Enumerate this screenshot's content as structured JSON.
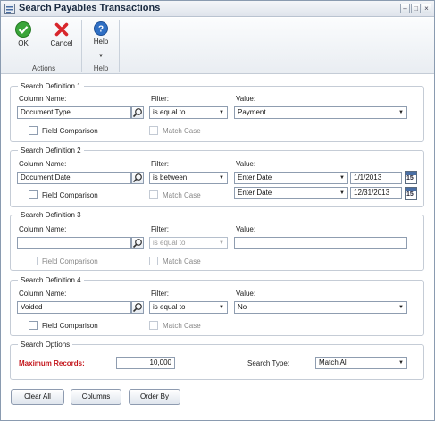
{
  "window": {
    "title": "Search Payables Transactions"
  },
  "ribbon": {
    "ok_label": "OK",
    "cancel_label": "Cancel",
    "help_label": "Help",
    "actions_group": "Actions",
    "help_group": "Help"
  },
  "labels": {
    "column_name": "Column Name:",
    "filter": "Filter:",
    "value": "Value:",
    "field_comparison": "Field Comparison",
    "match_case": "Match Case"
  },
  "def1": {
    "title": "Search Definition 1",
    "column": "Document Type",
    "filter": "is equal to",
    "value": "Payment"
  },
  "def2": {
    "title": "Search Definition 2",
    "column": "Document Date",
    "filter": "is between",
    "value1_type": "Enter Date",
    "value1_date": "1/1/2013",
    "value2_type": "Enter Date",
    "value2_date": "12/31/2013",
    "calendar_day": "15"
  },
  "def3": {
    "title": "Search Definition 3",
    "column": "",
    "filter": "is equal to",
    "value": ""
  },
  "def4": {
    "title": "Search Definition 4",
    "column": "Voided",
    "filter": "is equal to",
    "value": "No"
  },
  "options": {
    "title": "Search Options",
    "max_records_label": "Maximum Records:",
    "max_records": "10,000",
    "search_type_label": "Search Type:",
    "search_type": "Match All"
  },
  "buttons": {
    "clear_all": "Clear All",
    "columns": "Columns",
    "order_by": "Order By"
  },
  "colors": {
    "ok_green": "#3aa53a",
    "cancel_red": "#d8262c",
    "help_blue": "#2f6fc4",
    "required_red": "#c4161c"
  }
}
